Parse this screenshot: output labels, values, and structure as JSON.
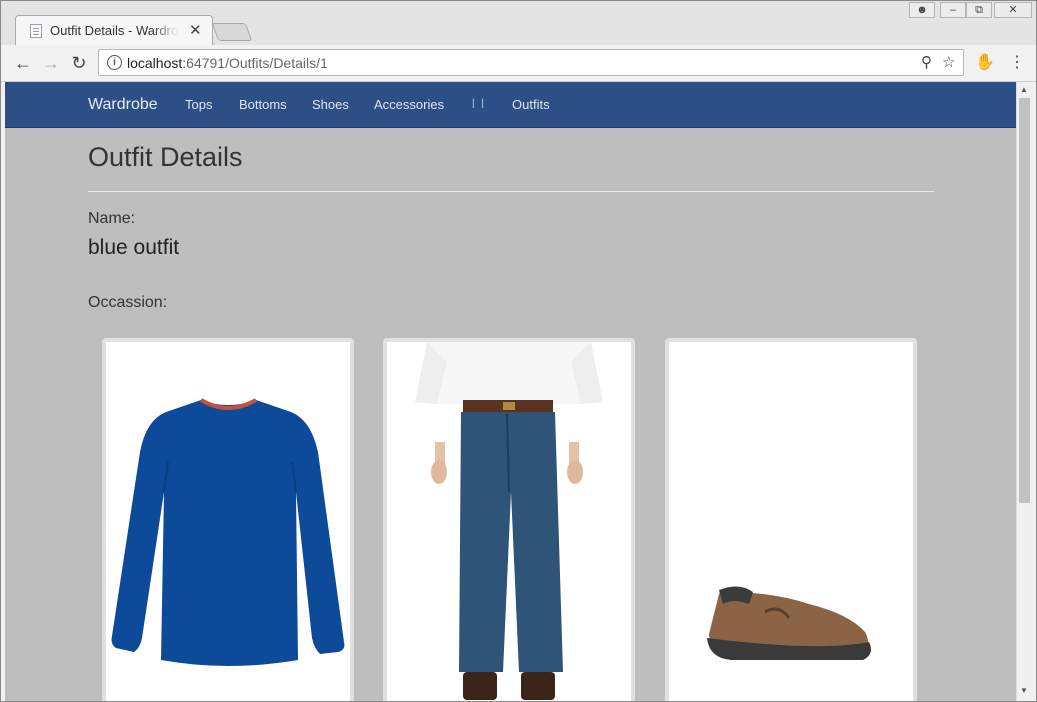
{
  "browser": {
    "tab_title": "Outfit Details - Wardrobe",
    "url_host": "localhost",
    "url_path": ":64791/Outfits/Details/1"
  },
  "site": {
    "brand": "Wardrobe",
    "nav": [
      "Tops",
      "Bottoms",
      "Shoes",
      "Accessories"
    ],
    "separator": "| |",
    "nav_right": "Outfits"
  },
  "page": {
    "title": "Outfit Details",
    "name_label": "Name:",
    "name_value": "blue outfit",
    "occasion_label": "Occassion:"
  },
  "items": [
    "blue long-sleeve t-shirt",
    "blue jeans",
    "brown slip-on shoe"
  ],
  "colors": {
    "navbar": "#2d4f86",
    "page_bg": "#bebebe"
  }
}
